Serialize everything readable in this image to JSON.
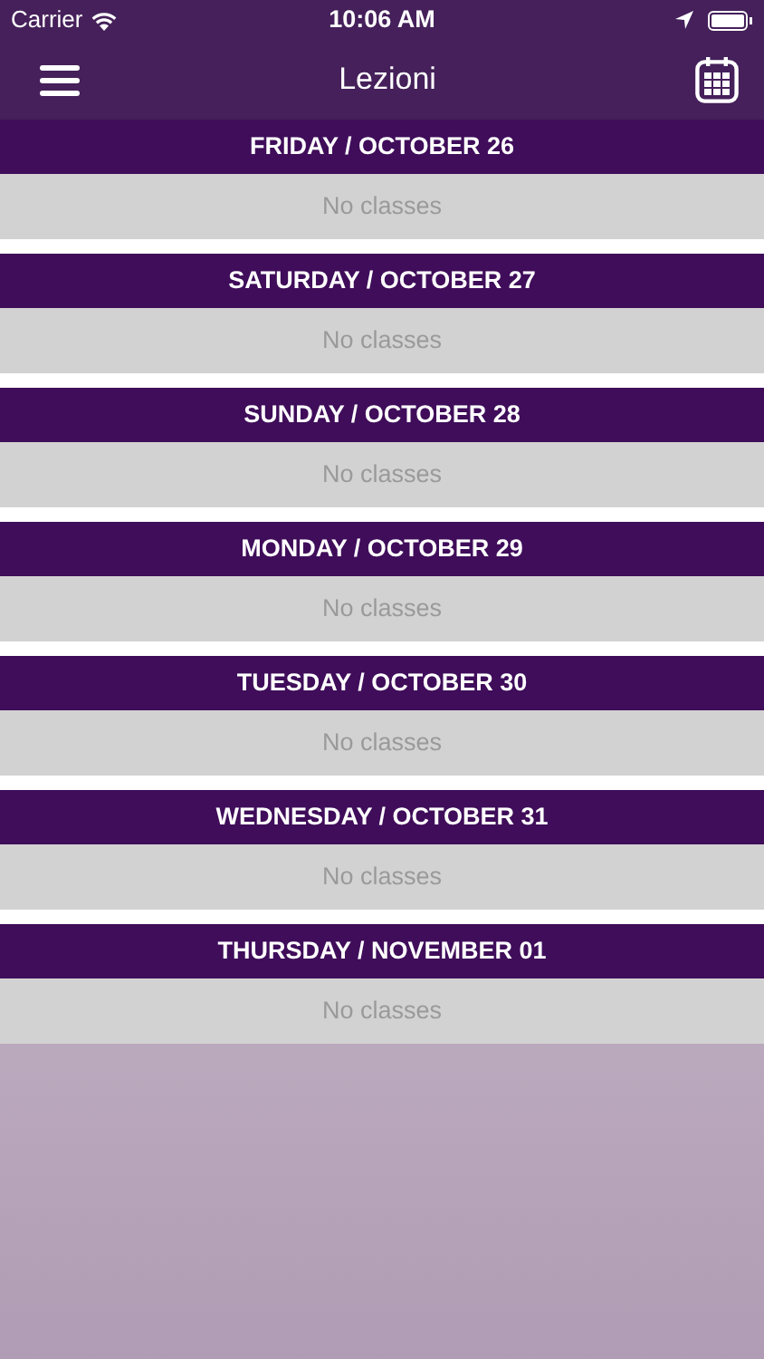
{
  "status_bar": {
    "carrier": "Carrier",
    "time": "10:06 AM"
  },
  "nav_bar": {
    "title": "Lezioni"
  },
  "days": [
    {
      "header": "FRIDAY / OCTOBER 26",
      "message": "No classes"
    },
    {
      "header": "SATURDAY / OCTOBER 27",
      "message": "No classes"
    },
    {
      "header": "SUNDAY / OCTOBER 28",
      "message": "No classes"
    },
    {
      "header": "MONDAY / OCTOBER 29",
      "message": "No classes"
    },
    {
      "header": "TUESDAY / OCTOBER 30",
      "message": "No classes"
    },
    {
      "header": "WEDNESDAY / OCTOBER 31",
      "message": "No classes"
    },
    {
      "header": "THURSDAY / NOVEMBER 01",
      "message": "No classes"
    }
  ]
}
